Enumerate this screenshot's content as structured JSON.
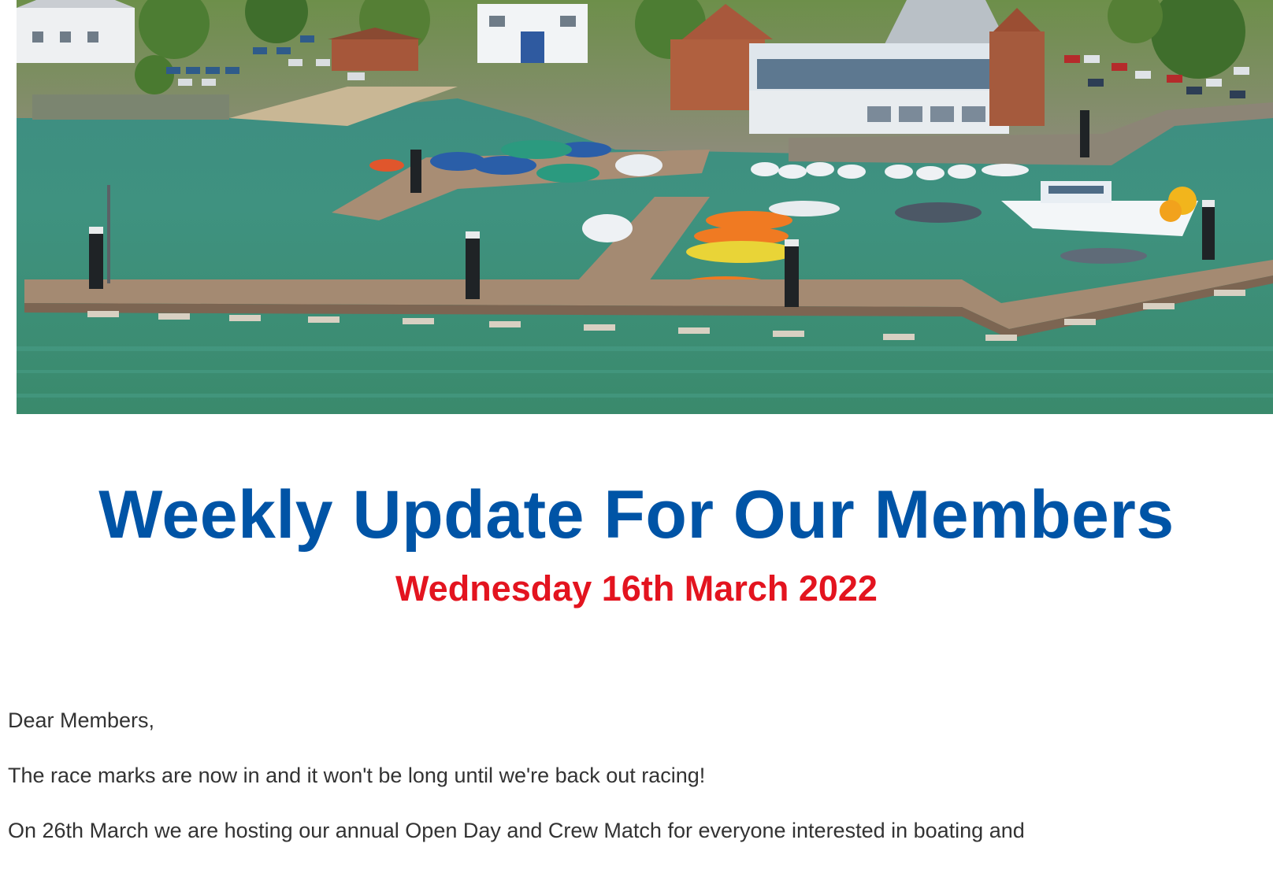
{
  "header_image": {
    "alt_icon": "marina-photo",
    "description_colors": {
      "water": "#3f8f7b",
      "pontoon": "#9a7d66",
      "sky_trees": "#4f8a3a"
    }
  },
  "newsletter": {
    "title": "Weekly Update For Our Members",
    "date": "Wednesday 16th March 2022",
    "title_color": "#0054a6",
    "date_color": "#e3141f"
  },
  "body": {
    "greeting": "Dear Members,",
    "paragraph_1": "The race marks are now in and it won't be long until we're back out racing!",
    "paragraph_2_line_1": "On 26th March we are hosting our annual Open Day and Crew Match for everyone interested in boating and"
  }
}
